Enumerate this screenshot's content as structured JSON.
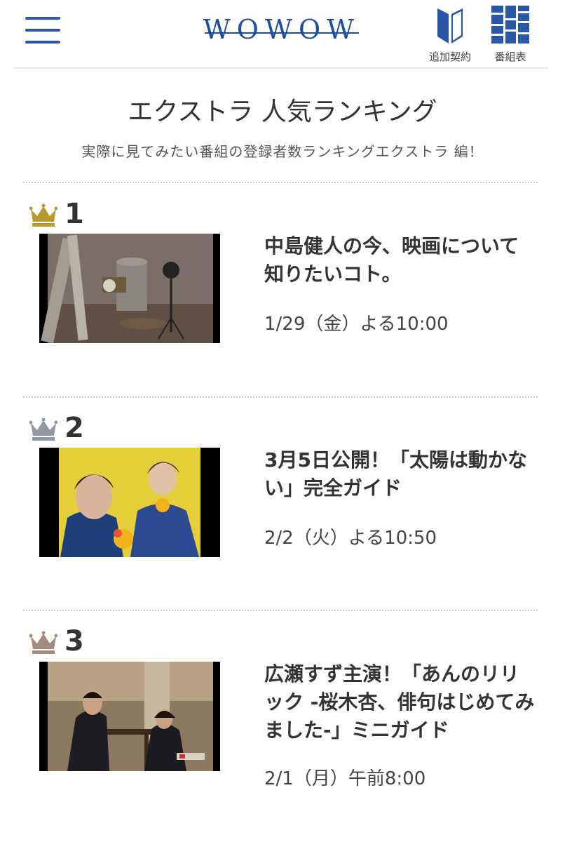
{
  "header": {
    "logo": "WOWOW",
    "nav": [
      {
        "label": "追加契約",
        "icon": "beginner-mark-icon"
      },
      {
        "label": "番組表",
        "icon": "program-grid-icon"
      }
    ],
    "menu_icon": "hamburger-menu-icon"
  },
  "page": {
    "title": "エクストラ 人気ランキング",
    "subtitle": "実際に見てみたい番組の登録者数ランキングエクストラ 編！"
  },
  "ranking": [
    {
      "rank": "1",
      "crown": "gold-crown-icon",
      "crown_color": "#b89a2a",
      "title": "中島健人の今、映画について知りたいコト。",
      "date": "1/29（金）よる10:00"
    },
    {
      "rank": "2",
      "crown": "silver-crown-icon",
      "crown_color": "#8e99a6",
      "title": "3月5日公開！「太陽は動かない」完全ガイド",
      "date": "2/2（火）よる10:50"
    },
    {
      "rank": "3",
      "crown": "bronze-crown-icon",
      "crown_color": "#a68a7e",
      "title": "広瀬すず主演！「あんのリリック -桜木杏、俳句はじめてみました-」ミニガイド",
      "date": "2/1（月）午前8:00"
    }
  ],
  "colors": {
    "brand": "#1e4ea1",
    "divider": "#cfcfcf"
  }
}
